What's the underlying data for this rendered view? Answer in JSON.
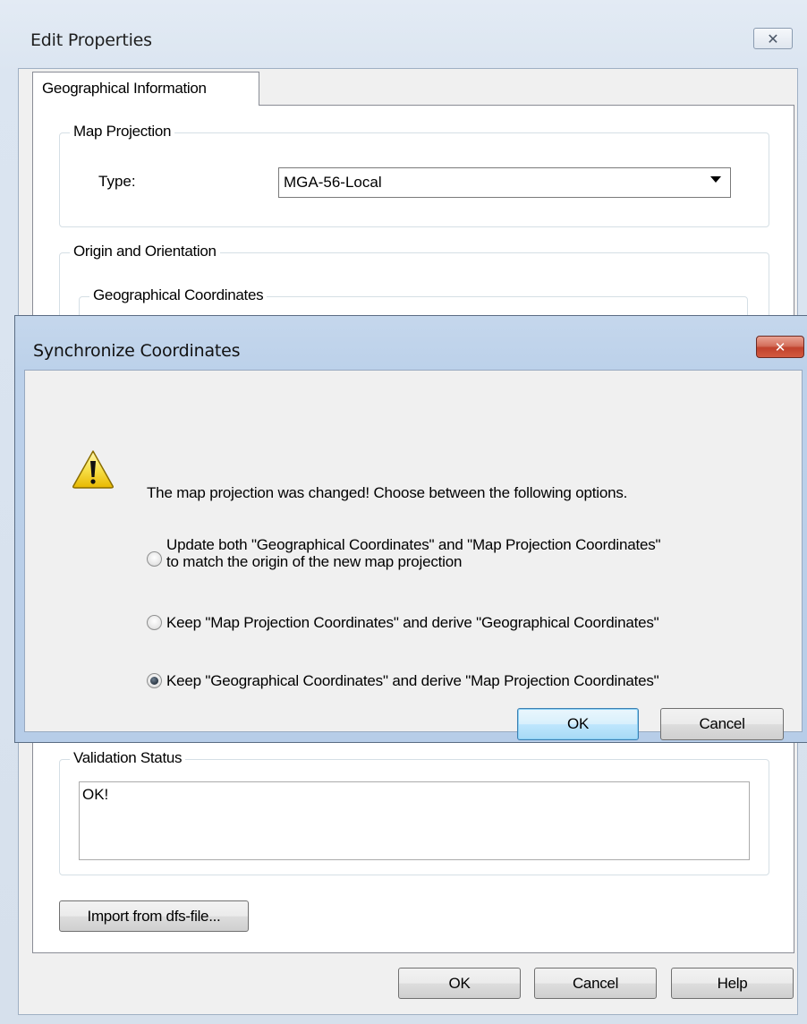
{
  "edit_properties": {
    "title": "Edit Properties",
    "close_glyph": "✕",
    "tab_label": "Geographical Information",
    "map_projection": {
      "group_label": "Map Projection",
      "type_label": "Type:",
      "type_value": "MGA-56-Local"
    },
    "origin_orientation": {
      "group_label": "Origin and Orientation",
      "geo_coords_label": "Geographical Coordinates"
    },
    "validation": {
      "group_label": "Validation Status",
      "text": "OK!"
    },
    "import_button": "Import from dfs-file...",
    "ok_button": "OK",
    "cancel_button": "Cancel",
    "help_button": "Help"
  },
  "sync_dialog": {
    "title": "Synchronize Coordinates",
    "close_glyph": "✕",
    "message": "The map projection was changed! Choose between the following options.",
    "options": [
      {
        "line1": "Update both \"Geographical Coordinates\" and \"Map Projection Coordinates\"",
        "line2": "to match the origin of the new map projection",
        "checked": false
      },
      {
        "line1": "Keep \"Map Projection Coordinates\" and derive \"Geographical Coordinates\"",
        "line2": "",
        "checked": false
      },
      {
        "line1": "Keep \"Geographical Coordinates\" and derive \"Map Projection Coordinates\"",
        "line2": "",
        "checked": true
      }
    ],
    "ok_button": "OK",
    "cancel_button": "Cancel",
    "warning_icon": "warning-triangle-icon",
    "close_color": "#c7432c",
    "accent_color": "#3c7fb1"
  }
}
